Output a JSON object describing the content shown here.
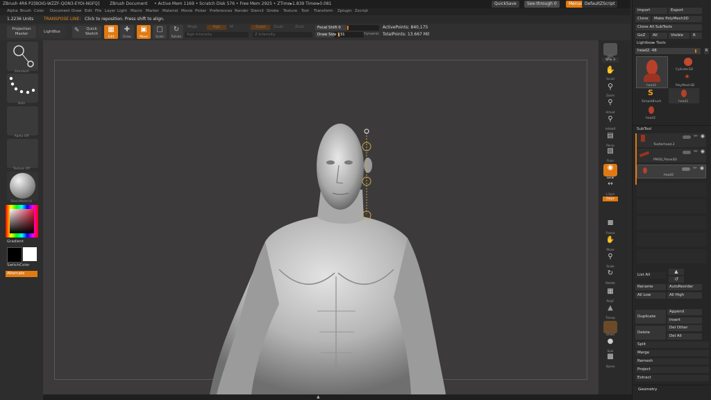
{
  "titlebar": {
    "app": "ZBrush 4R6 P2[BOIG-WZZF-QON3-EYOI-NGFQ]",
    "document": "ZBrush Document",
    "stats": "• Active Mem 1169 • Scratch Disk 576 • Free Mem 2925 • ZTime▸1.839 Timer▸0.081",
    "quicksave": "QuickSave",
    "seethrough": "See-through  0",
    "menus_btn": "Menus",
    "script": "DefaultZScript"
  },
  "menubar": [
    "Alpha",
    "Brush",
    "Color",
    "Document",
    "Draw",
    "Edit",
    "File",
    "Layer",
    "Light",
    "Macro",
    "Marker",
    "Material",
    "Movie",
    "Picker",
    "Preferences",
    "Render",
    "Stencil",
    "Stroke",
    "Texture",
    "Tool",
    "Transform",
    "Zplugin",
    "Zscript"
  ],
  "status": {
    "units": "1.2236 Units",
    "mode": "TRANSPOSE LINE:",
    "hint": "Click to reposition. Press shift to align."
  },
  "toolbar": {
    "projection_master": "Projection Master",
    "lightbox": "LightBox",
    "quick_sketch": "Quick Sketch",
    "edit": "Edit",
    "draw": "Draw",
    "move": "Move",
    "scale": "Scale",
    "rotate": "Rotate",
    "mrgb": "Mrgb",
    "rgb": "Rgb",
    "m": "M",
    "zadd": "Zadd",
    "zsub": "Zsub",
    "zcut": "Zcut",
    "rgb_intensity": "Rgb Intensity",
    "z_intensity": "Z Intensity",
    "focal_shift": "Focal Shift 0",
    "draw_size": "Draw Size 131",
    "dynamic": "Dynamic",
    "active_points": "ActivePoints: 840,175",
    "total_points": "TotalPoints: 13.667 Mil"
  },
  "leftshelf": {
    "brush": "Standard",
    "stroke": "Dots",
    "alpha": "Alpha Off",
    "texture": "Texture Off",
    "material": "BasicMaterial",
    "gradient": "Gradient",
    "switchcolor": "SwitchColor",
    "alternate": "Alternate"
  },
  "rightshelf": [
    "BPR",
    "SPix 3",
    "Scroll",
    "Zoom",
    "Actual",
    "AAHalf",
    "Persp",
    "Floor",
    "Local",
    "L.Sym",
    "Gxyz",
    "Frame",
    "Move",
    "Scale",
    "Rotate",
    "PolyF",
    "Transp",
    "Ghost",
    "Solo",
    "Xpose"
  ],
  "panel": {
    "import": "Import",
    "export": "Export",
    "clone": "Clone",
    "make_polymesh": "Make PolyMesh3D",
    "clone_all": "Clone All SubTools",
    "goz": "GoZ",
    "all": "All",
    "visible": "Visible",
    "r": "R",
    "lightbox_tools": "Lightbox▸ Tools",
    "current_tool": "head2. 48",
    "tools": [
      {
        "name": "head2"
      },
      {
        "name": "Cylinder3D"
      },
      {
        "name": "PolyMesh3D"
      },
      {
        "name": "SimpleBrush"
      },
      {
        "name": "head2"
      },
      {
        "name": "head2"
      }
    ],
    "subtool_title": "SubTool",
    "subtools": [
      "Toolterhead.2",
      "PM3D_Plane3D",
      "head2"
    ],
    "list_all": "List All",
    "rename": "Rename",
    "autoreorder": "AutoReorder",
    "all_low": "All Low",
    "all_high": "All High",
    "duplicate": "Duplicate",
    "append": "Append",
    "insert": "Insert",
    "delete": "Delete",
    "del_other": "Del Other",
    "del_all": "Del All",
    "split": "Split",
    "merge": "Merge",
    "remesh": "Remesh",
    "project": "Project",
    "extract": "Extract",
    "geometry": "Geometry"
  }
}
